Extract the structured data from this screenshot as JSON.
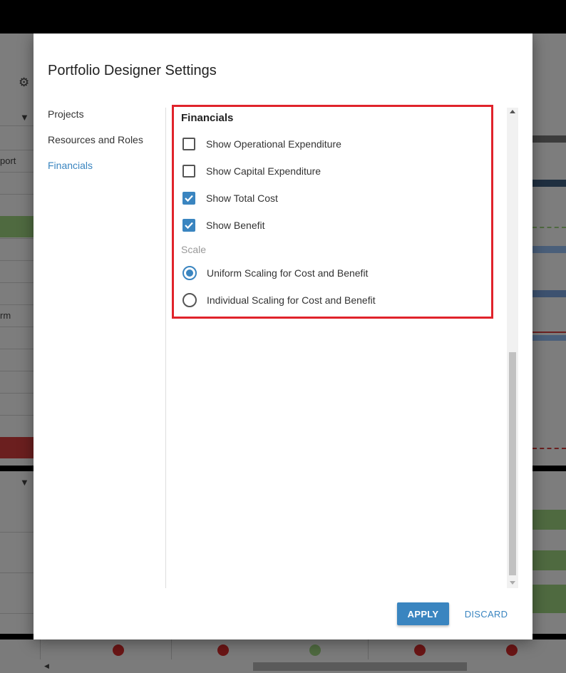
{
  "background": {
    "left_texts": [
      "port",
      "rm"
    ],
    "dot_colors": [
      "#6b1515",
      "#6b1515",
      "#4f6a40",
      "#6b1515",
      "#6b1515"
    ]
  },
  "dialog": {
    "title": "Portfolio Designer Settings",
    "nav": [
      {
        "label": "Projects",
        "active": false
      },
      {
        "label": "Resources and Roles",
        "active": false
      },
      {
        "label": "Financials",
        "active": true
      }
    ],
    "section": {
      "title": "Financials",
      "checkboxes": [
        {
          "label": "Show Operational Expenditure",
          "checked": false
        },
        {
          "label": "Show Capital Expenditure",
          "checked": false
        },
        {
          "label": "Show Total Cost",
          "checked": true
        },
        {
          "label": "Show Benefit",
          "checked": true
        }
      ],
      "scale_label": "Scale",
      "radios": [
        {
          "label": "Uniform Scaling for Cost and Benefit",
          "selected": true
        },
        {
          "label": "Individual Scaling for Cost and Benefit",
          "selected": false
        }
      ]
    },
    "buttons": {
      "apply": "APPLY",
      "discard": "DISCARD"
    }
  },
  "colors": {
    "accent": "#3a85c0",
    "highlight": "#e0232b"
  }
}
